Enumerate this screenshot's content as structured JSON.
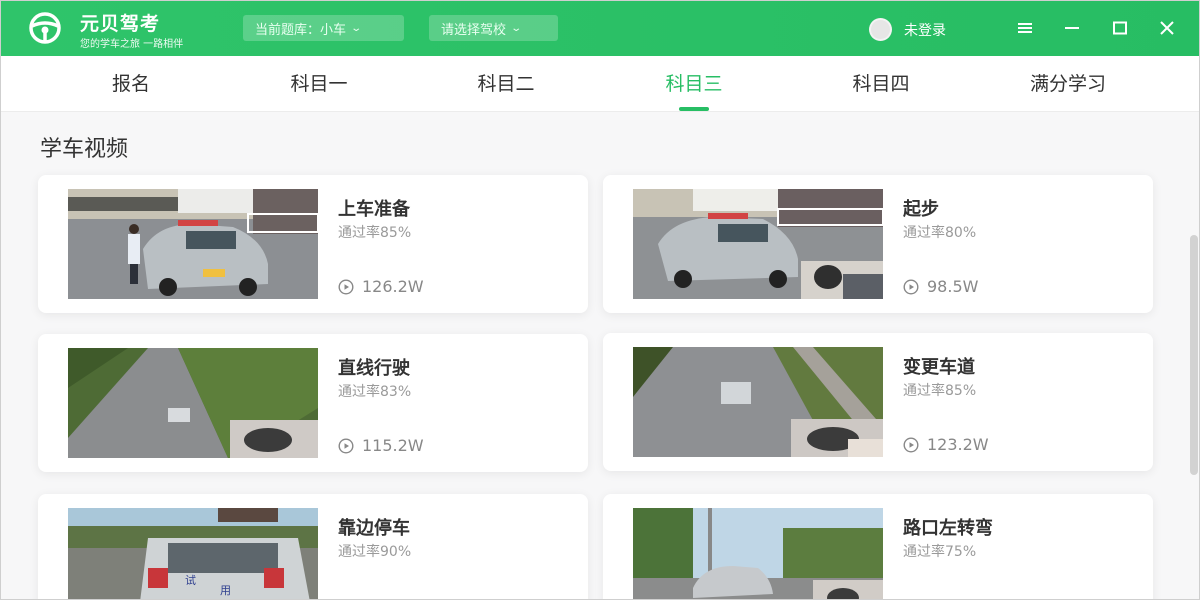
{
  "app": {
    "name": "元贝驾考",
    "slogan": "您的学车之旅 一路相伴",
    "logo_icon": "steering-wheel-icon"
  },
  "header": {
    "question_bank": "当前题库：小车",
    "driving_school": "请选择驾校",
    "user_status": "未登录",
    "menu_icon": "menu-icon",
    "minimize_icon": "minimize-icon",
    "maximize_icon": "maximize-icon",
    "close_icon": "close-icon"
  },
  "tabs": [
    {
      "label": "报名"
    },
    {
      "label": "科目一"
    },
    {
      "label": "科目二"
    },
    {
      "label": "科目三",
      "active": true
    },
    {
      "label": "科目四"
    },
    {
      "label": "满分学习"
    }
  ],
  "section_title": "学车视频",
  "videos": [
    {
      "title": "上车准备",
      "pass_rate": "通过率85%",
      "views": "126.2W"
    },
    {
      "title": "起步",
      "pass_rate": "通过率80%",
      "views": "98.5W"
    },
    {
      "title": "直线行驶",
      "pass_rate": "通过率83%",
      "views": "115.2W"
    },
    {
      "title": "变更车道",
      "pass_rate": "通过率85%",
      "views": "123.2W"
    },
    {
      "title": "靠边停车",
      "pass_rate": "通过率90%",
      "views": ""
    },
    {
      "title": "路口左转弯",
      "pass_rate": "通过率75%",
      "views": ""
    }
  ],
  "thumbnail_labels": {
    "rear_plate": "试",
    "rear_text": "用"
  },
  "colors": {
    "brand_green": "#27be64",
    "title_bar": "#2fc46a"
  }
}
